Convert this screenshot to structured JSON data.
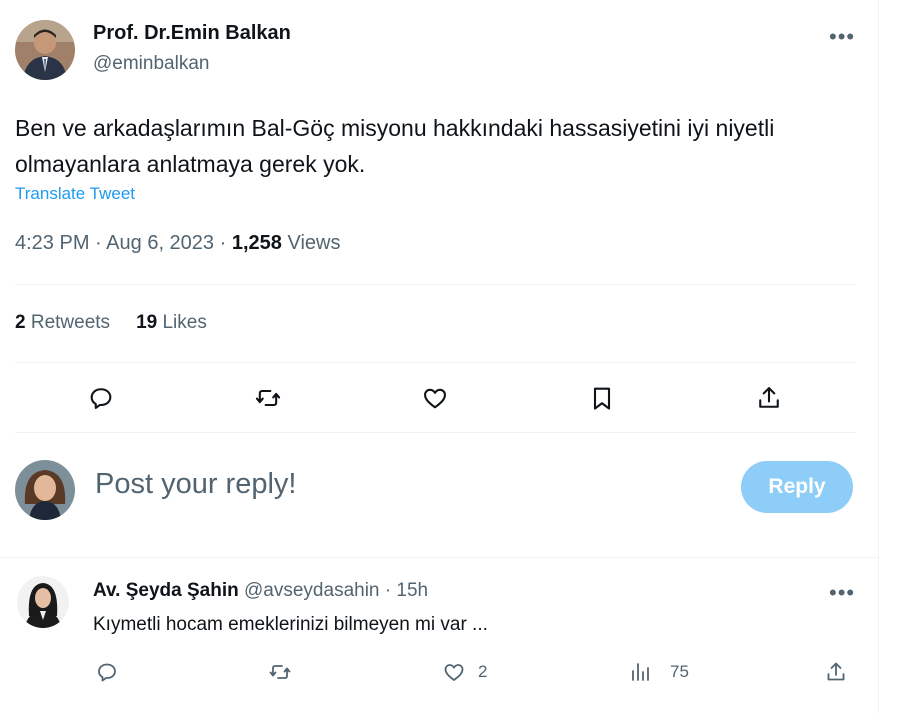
{
  "tweet": {
    "author_name": "Prof. Dr.Emin Balkan",
    "author_handle": "@eminbalkan",
    "more_label": "•••",
    "text": "Ben ve arkadaşlarımın Bal-Göç misyonu hakkındaki  hassasiyetini iyi niyetli olmayanlara anlatmaya gerek yok.",
    "translate_label": "Translate Tweet",
    "time": "4:23 PM",
    "date": "Aug 6, 2023",
    "separator": "·",
    "views_count": "1,258",
    "views_label": "Views"
  },
  "stats": {
    "retweets_count": "2",
    "retweets_label": "Retweets",
    "likes_count": "19",
    "likes_label": "Likes"
  },
  "actions": {
    "icons": [
      "reply-icon",
      "retweet-icon",
      "like-icon",
      "bookmark-icon",
      "share-icon"
    ]
  },
  "reply_composer": {
    "placeholder": "Post your reply!",
    "button_label": "Reply"
  },
  "comment": {
    "author_name": "Av. Şeyda Şahin",
    "author_handle": "@avseydasahin",
    "separator": "·",
    "time_ago": "15h",
    "text": "Kıymetli hocam emeklerinizi bilmeyen mi var ...",
    "more_label": "•••",
    "likes_count": "2",
    "views_count": "75"
  },
  "colors": {
    "primary_text": "#0f1419",
    "secondary_text": "#536471",
    "link": "#1d9bf0",
    "reply_button_disabled": "#8ecdf8",
    "divider": "#eff3f4"
  }
}
